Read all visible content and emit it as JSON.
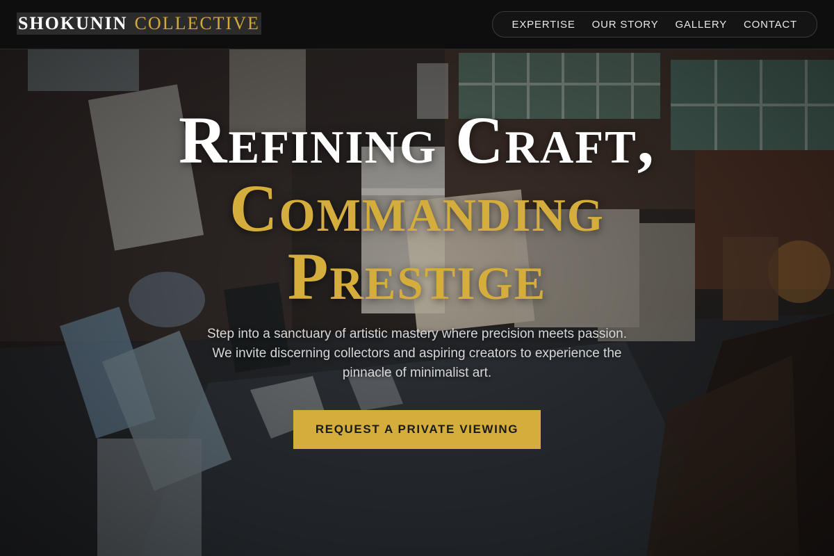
{
  "brand": {
    "word1": "SHOKUNIN",
    "word2": "COLLECTIVE"
  },
  "nav": {
    "items": [
      {
        "label": "EXPERTISE"
      },
      {
        "label": "OUR STORY"
      },
      {
        "label": "GALLERY"
      },
      {
        "label": "CONTACT"
      }
    ]
  },
  "hero": {
    "headline_line1": "Refining Craft,",
    "headline_line2": "Commanding",
    "headline_line3": "Prestige",
    "subtext": "Step into a sanctuary of artistic mastery where precision meets passion. We invite discerning collectors and aspiring creators to experience the pinnacle of minimalist art.",
    "cta_label": "REQUEST A PRIVATE VIEWING"
  },
  "colors": {
    "accent_gold": "#d4ad3c",
    "header_bg": "#0e0e0e",
    "text_light": "#ffffff"
  }
}
